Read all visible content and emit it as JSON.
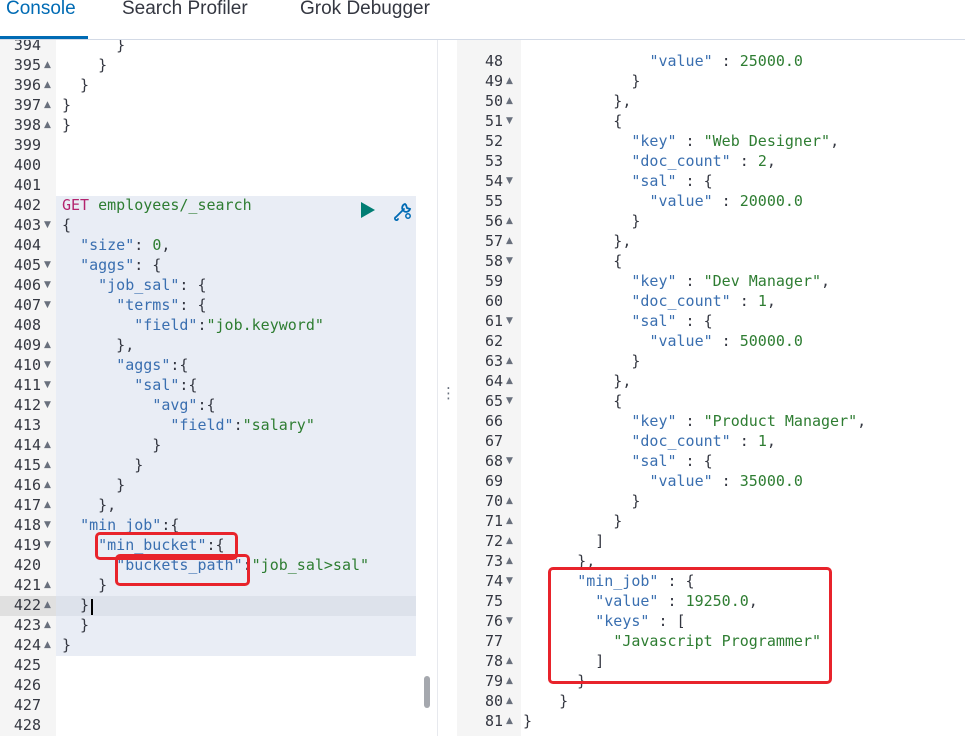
{
  "tabs": [
    {
      "label": "Console",
      "active": true
    },
    {
      "label": "Search Profiler",
      "active": false
    },
    {
      "label": "Grok Debugger",
      "active": false
    }
  ],
  "colors": {
    "accent": "#006bb4",
    "highlight_box": "#e8232b"
  },
  "icons": {
    "run": "play-icon",
    "settings": "wrench-icon",
    "divider": "vertical-ellipsis-icon"
  },
  "left_editor": {
    "lines": [
      {
        "n": "394",
        "fold": "",
        "code": "      }"
      },
      {
        "n": "395",
        "fold": "▲",
        "code": "    }"
      },
      {
        "n": "396",
        "fold": "▲",
        "code": "  }"
      },
      {
        "n": "397",
        "fold": "▲",
        "code": "}"
      },
      {
        "n": "398",
        "fold": "▲",
        "code": "}"
      },
      {
        "n": "399",
        "fold": "",
        "code": ""
      },
      {
        "n": "400",
        "fold": "",
        "code": ""
      },
      {
        "n": "401",
        "fold": "",
        "code": ""
      },
      {
        "n": "402",
        "fold": "",
        "code": "GET employees/_search"
      },
      {
        "n": "403",
        "fold": "▼",
        "code": "{"
      },
      {
        "n": "404",
        "fold": "",
        "code": "  \"size\": 0,"
      },
      {
        "n": "405",
        "fold": "▼",
        "code": "  \"aggs\": {"
      },
      {
        "n": "406",
        "fold": "▼",
        "code": "    \"job_sal\": {"
      },
      {
        "n": "407",
        "fold": "▼",
        "code": "      \"terms\": {"
      },
      {
        "n": "408",
        "fold": "",
        "code": "        \"field\":\"job.keyword\""
      },
      {
        "n": "409",
        "fold": "▲",
        "code": "      },"
      },
      {
        "n": "410",
        "fold": "▼",
        "code": "      \"aggs\":{"
      },
      {
        "n": "411",
        "fold": "▼",
        "code": "        \"sal\":{"
      },
      {
        "n": "412",
        "fold": "▼",
        "code": "          \"avg\":{"
      },
      {
        "n": "413",
        "fold": "",
        "code": "            \"field\":\"salary\""
      },
      {
        "n": "414",
        "fold": "▲",
        "code": "          }"
      },
      {
        "n": "415",
        "fold": "▲",
        "code": "        }"
      },
      {
        "n": "416",
        "fold": "▲",
        "code": "      }"
      },
      {
        "n": "417",
        "fold": "▲",
        "code": "    },"
      },
      {
        "n": "418",
        "fold": "▼",
        "code": "  \"min_job\":{"
      },
      {
        "n": "419",
        "fold": "▼",
        "code": "    \"min_bucket\":{"
      },
      {
        "n": "420",
        "fold": "",
        "code": "      \"buckets_path\":\"job_sal>sal\""
      },
      {
        "n": "421",
        "fold": "▲",
        "code": "    }"
      },
      {
        "n": "422",
        "fold": "▲",
        "code": "  }"
      },
      {
        "n": "423",
        "fold": "▲",
        "code": "  }"
      },
      {
        "n": "424",
        "fold": "▲",
        "code": "}"
      },
      {
        "n": "425",
        "fold": "",
        "code": ""
      },
      {
        "n": "426",
        "fold": "",
        "code": ""
      },
      {
        "n": "427",
        "fold": "",
        "code": ""
      },
      {
        "n": "428",
        "fold": "",
        "code": ""
      }
    ],
    "request_method": "GET",
    "request_path": "employees/_search"
  },
  "right_editor": {
    "lines": [
      {
        "n": "48",
        "fold": "",
        "code": "              \"value\" : 25000.0"
      },
      {
        "n": "49",
        "fold": "▲",
        "code": "            }"
      },
      {
        "n": "50",
        "fold": "▲",
        "code": "          },"
      },
      {
        "n": "51",
        "fold": "▼",
        "code": "          {"
      },
      {
        "n": "52",
        "fold": "",
        "code": "            \"key\" : \"Web Designer\","
      },
      {
        "n": "53",
        "fold": "",
        "code": "            \"doc_count\" : 2,"
      },
      {
        "n": "54",
        "fold": "▼",
        "code": "            \"sal\" : {"
      },
      {
        "n": "55",
        "fold": "",
        "code": "              \"value\" : 20000.0"
      },
      {
        "n": "56",
        "fold": "▲",
        "code": "            }"
      },
      {
        "n": "57",
        "fold": "▲",
        "code": "          },"
      },
      {
        "n": "58",
        "fold": "▼",
        "code": "          {"
      },
      {
        "n": "59",
        "fold": "",
        "code": "            \"key\" : \"Dev Manager\","
      },
      {
        "n": "60",
        "fold": "",
        "code": "            \"doc_count\" : 1,"
      },
      {
        "n": "61",
        "fold": "▼",
        "code": "            \"sal\" : {"
      },
      {
        "n": "62",
        "fold": "",
        "code": "              \"value\" : 50000.0"
      },
      {
        "n": "63",
        "fold": "▲",
        "code": "            }"
      },
      {
        "n": "64",
        "fold": "▲",
        "code": "          },"
      },
      {
        "n": "65",
        "fold": "▼",
        "code": "          {"
      },
      {
        "n": "66",
        "fold": "",
        "code": "            \"key\" : \"Product Manager\","
      },
      {
        "n": "67",
        "fold": "",
        "code": "            \"doc_count\" : 1,"
      },
      {
        "n": "68",
        "fold": "▼",
        "code": "            \"sal\" : {"
      },
      {
        "n": "69",
        "fold": "",
        "code": "              \"value\" : 35000.0"
      },
      {
        "n": "70",
        "fold": "▲",
        "code": "            }"
      },
      {
        "n": "71",
        "fold": "▲",
        "code": "          }"
      },
      {
        "n": "72",
        "fold": "▲",
        "code": "        ]"
      },
      {
        "n": "73",
        "fold": "▲",
        "code": "      },"
      },
      {
        "n": "74",
        "fold": "▼",
        "code": "      \"min_job\" : {"
      },
      {
        "n": "75",
        "fold": "",
        "code": "        \"value\" : 19250.0,"
      },
      {
        "n": "76",
        "fold": "▼",
        "code": "        \"keys\" : ["
      },
      {
        "n": "77",
        "fold": "",
        "code": "          \"Javascript Programmer\""
      },
      {
        "n": "78",
        "fold": "▲",
        "code": "        ]"
      },
      {
        "n": "79",
        "fold": "▲",
        "code": "      }"
      },
      {
        "n": "80",
        "fold": "▲",
        "code": "    }"
      },
      {
        "n": "81",
        "fold": "▲",
        "code": "}"
      }
    ]
  }
}
